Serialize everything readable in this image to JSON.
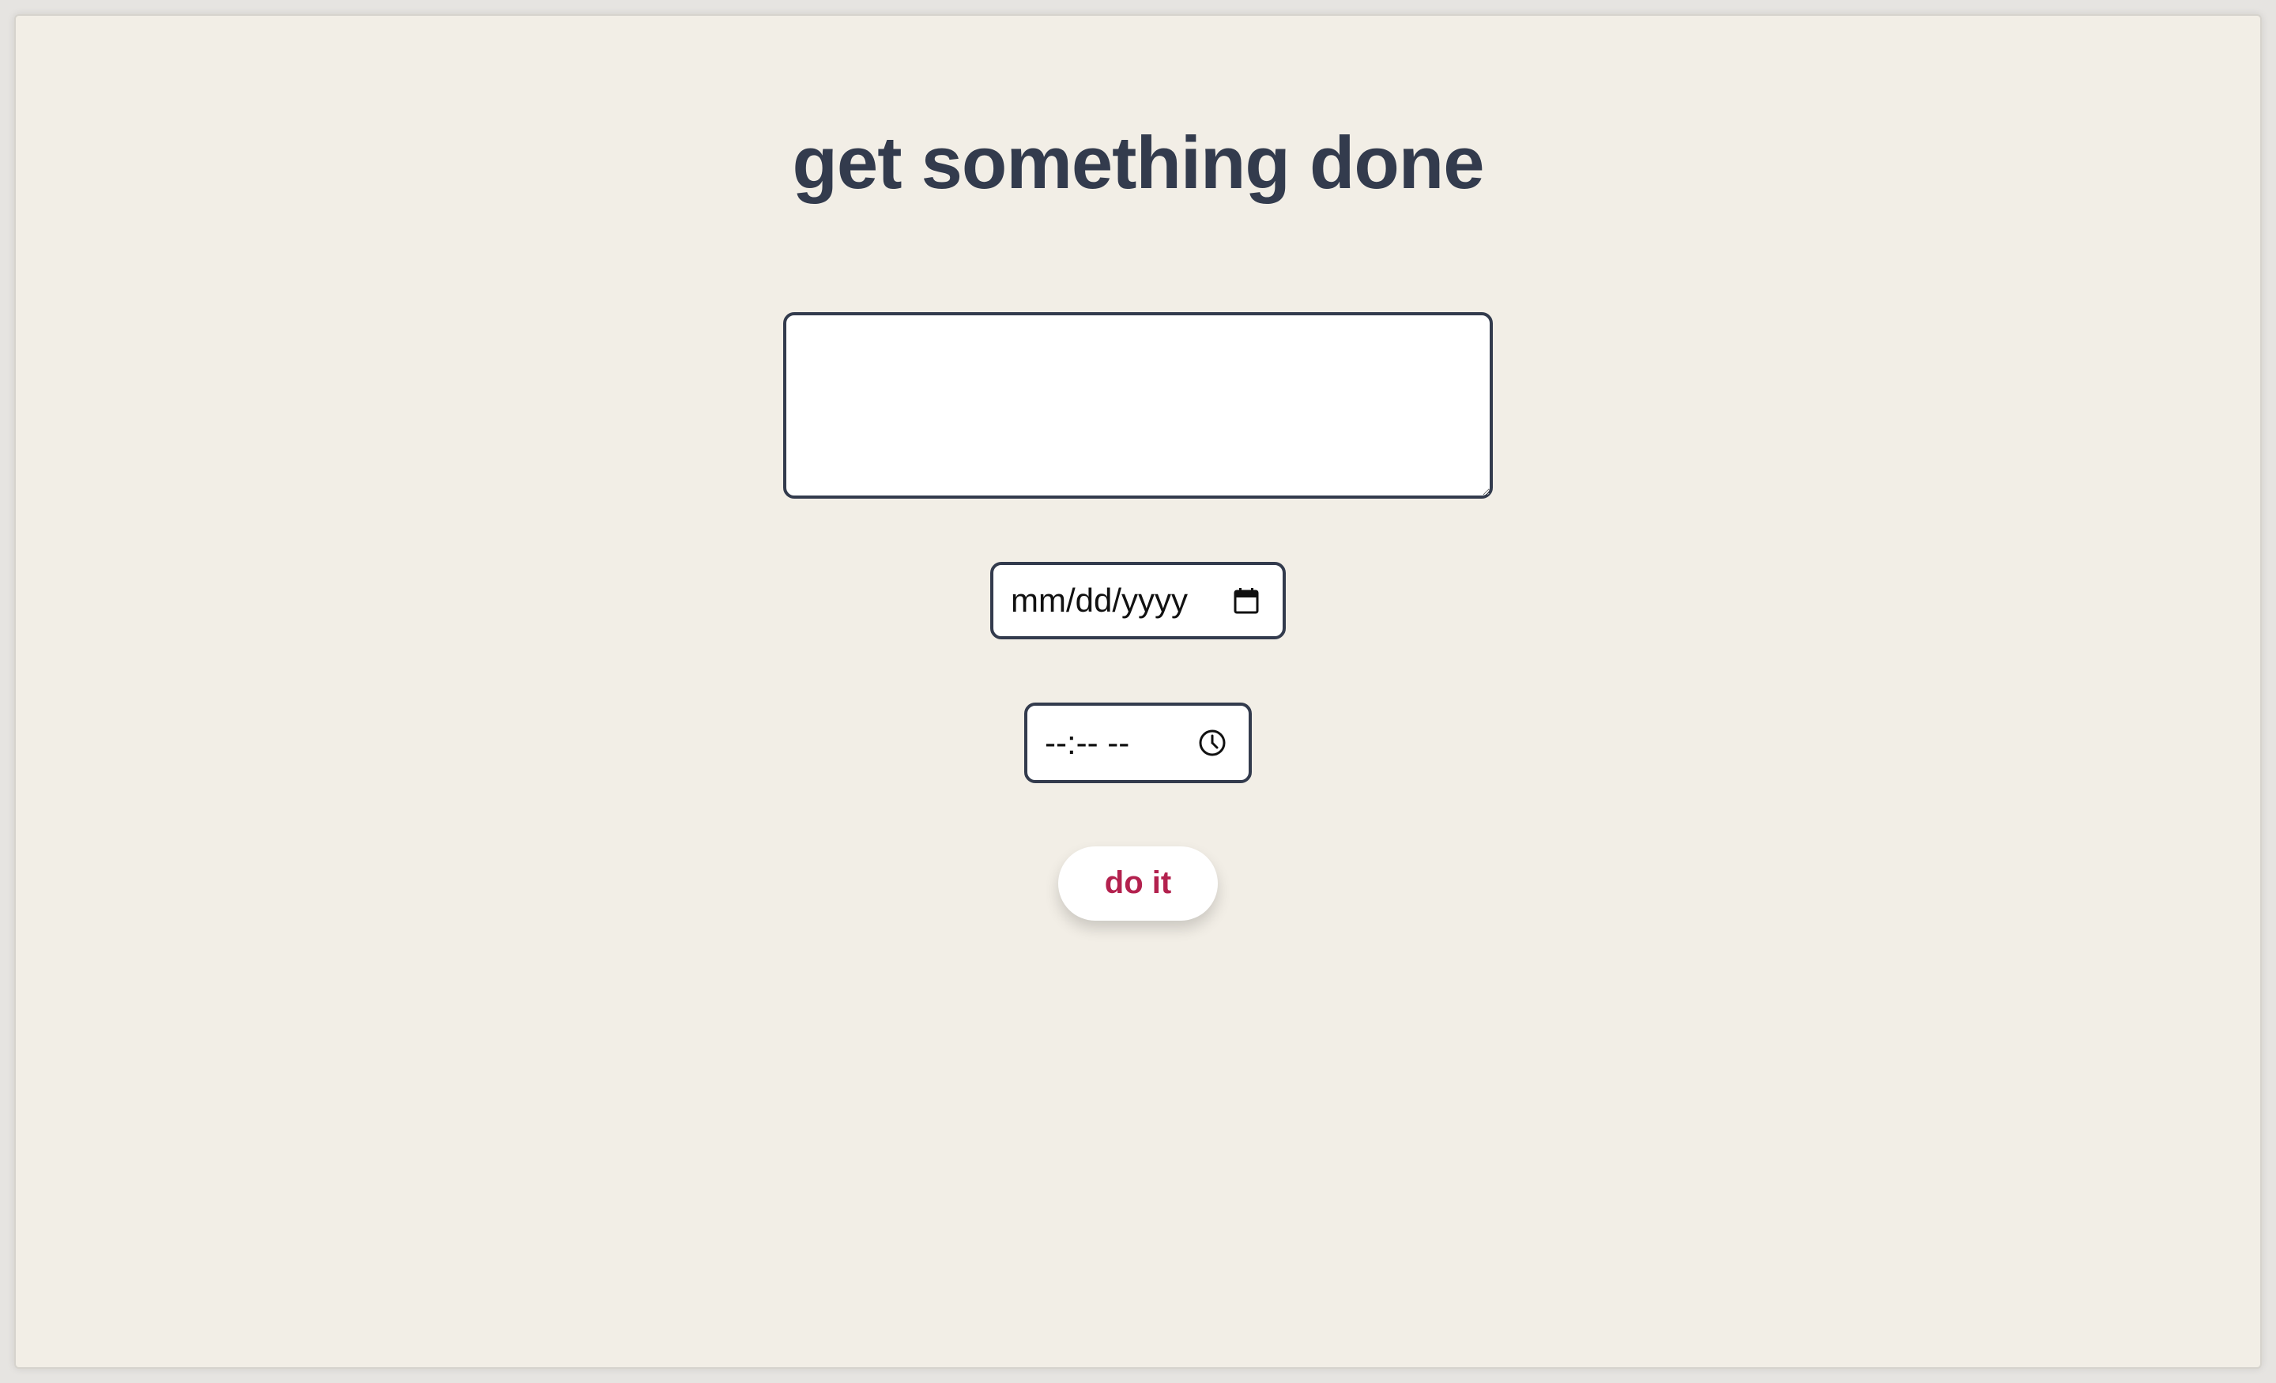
{
  "page": {
    "title": "get something done"
  },
  "form": {
    "task_text": "",
    "date": {
      "placeholder": "mm/dd/yyyy",
      "icon": "calendar-icon"
    },
    "time": {
      "placeholder": "--:-- --",
      "icon": "clock-icon"
    },
    "submit_label": "do it"
  },
  "colors": {
    "background": "#f2eee6",
    "text": "#333b4d",
    "accent": "#b3214e",
    "field_background": "#ffffff"
  }
}
